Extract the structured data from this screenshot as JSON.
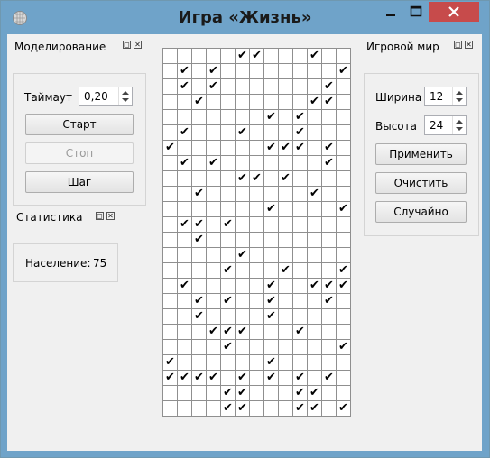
{
  "window": {
    "title": "Игра «Жизнь»"
  },
  "icons": {
    "app": "grid-sphere-icon",
    "minimize": "minimize-icon",
    "maximize": "maximize-icon",
    "close": "close-icon"
  },
  "colors": {
    "titlebar": "#6fa3c9",
    "close_button": "#c74b4b",
    "client": "#f0f0f0"
  },
  "modeling": {
    "title": "Моделирование",
    "timeout_label": "Таймаут",
    "timeout_value": "0,20",
    "start_label": "Старт",
    "stop_label": "Стоп",
    "stop_enabled": false,
    "step_label": "Шаг"
  },
  "stats": {
    "title": "Статистика",
    "population_label": "Население:",
    "population_value": "75"
  },
  "world": {
    "title": "Игровой мир",
    "width_label": "Ширина",
    "width_value": "12",
    "height_label": "Высота",
    "height_value": "24",
    "apply_label": "Применить",
    "clear_label": "Очистить",
    "random_label": "Случайно"
  },
  "grid": {
    "columns": 12,
    "rows": [
      "0000011000100",
      "0101000000001",
      "0101000000010",
      "0010000000110",
      "0000000101000",
      "0100010001000",
      "1000000111010",
      "0101000000010",
      "0000011010000",
      "0010000000100",
      "0000000100001",
      "0110100000000",
      "0010000000000",
      "0000010000000",
      "0000100010001",
      "0100000100111",
      "0010100100010",
      "0010000100000",
      "0001110001000",
      "0000100000001",
      "1000000100000",
      "1111010101010",
      "0000110001100",
      "0000110001101"
    ]
  }
}
